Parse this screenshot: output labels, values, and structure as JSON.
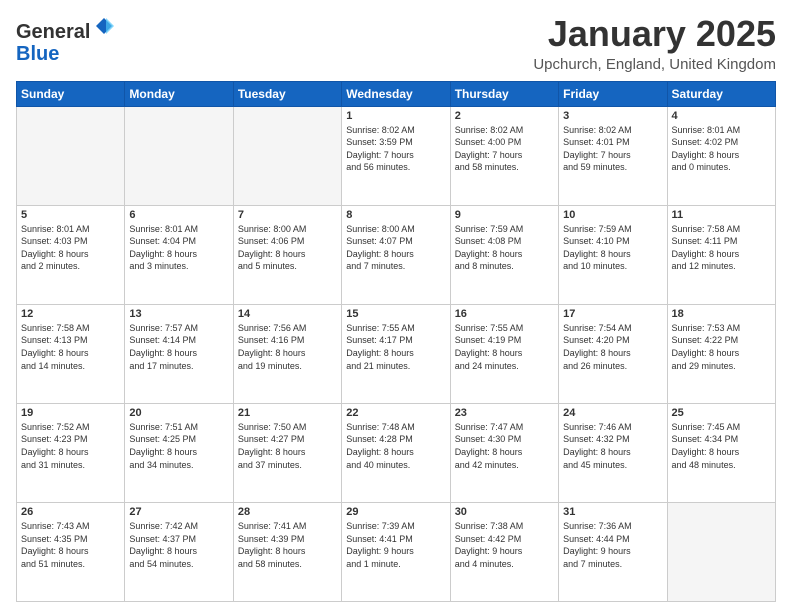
{
  "header": {
    "logo_general": "General",
    "logo_blue": "Blue",
    "month_title": "January 2025",
    "location": "Upchurch, England, United Kingdom"
  },
  "weekdays": [
    "Sunday",
    "Monday",
    "Tuesday",
    "Wednesday",
    "Thursday",
    "Friday",
    "Saturday"
  ],
  "weeks": [
    [
      {
        "day": "",
        "info": ""
      },
      {
        "day": "",
        "info": ""
      },
      {
        "day": "",
        "info": ""
      },
      {
        "day": "1",
        "info": "Sunrise: 8:02 AM\nSunset: 3:59 PM\nDaylight: 7 hours\nand 56 minutes."
      },
      {
        "day": "2",
        "info": "Sunrise: 8:02 AM\nSunset: 4:00 PM\nDaylight: 7 hours\nand 58 minutes."
      },
      {
        "day": "3",
        "info": "Sunrise: 8:02 AM\nSunset: 4:01 PM\nDaylight: 7 hours\nand 59 minutes."
      },
      {
        "day": "4",
        "info": "Sunrise: 8:01 AM\nSunset: 4:02 PM\nDaylight: 8 hours\nand 0 minutes."
      }
    ],
    [
      {
        "day": "5",
        "info": "Sunrise: 8:01 AM\nSunset: 4:03 PM\nDaylight: 8 hours\nand 2 minutes."
      },
      {
        "day": "6",
        "info": "Sunrise: 8:01 AM\nSunset: 4:04 PM\nDaylight: 8 hours\nand 3 minutes."
      },
      {
        "day": "7",
        "info": "Sunrise: 8:00 AM\nSunset: 4:06 PM\nDaylight: 8 hours\nand 5 minutes."
      },
      {
        "day": "8",
        "info": "Sunrise: 8:00 AM\nSunset: 4:07 PM\nDaylight: 8 hours\nand 7 minutes."
      },
      {
        "day": "9",
        "info": "Sunrise: 7:59 AM\nSunset: 4:08 PM\nDaylight: 8 hours\nand 8 minutes."
      },
      {
        "day": "10",
        "info": "Sunrise: 7:59 AM\nSunset: 4:10 PM\nDaylight: 8 hours\nand 10 minutes."
      },
      {
        "day": "11",
        "info": "Sunrise: 7:58 AM\nSunset: 4:11 PM\nDaylight: 8 hours\nand 12 minutes."
      }
    ],
    [
      {
        "day": "12",
        "info": "Sunrise: 7:58 AM\nSunset: 4:13 PM\nDaylight: 8 hours\nand 14 minutes."
      },
      {
        "day": "13",
        "info": "Sunrise: 7:57 AM\nSunset: 4:14 PM\nDaylight: 8 hours\nand 17 minutes."
      },
      {
        "day": "14",
        "info": "Sunrise: 7:56 AM\nSunset: 4:16 PM\nDaylight: 8 hours\nand 19 minutes."
      },
      {
        "day": "15",
        "info": "Sunrise: 7:55 AM\nSunset: 4:17 PM\nDaylight: 8 hours\nand 21 minutes."
      },
      {
        "day": "16",
        "info": "Sunrise: 7:55 AM\nSunset: 4:19 PM\nDaylight: 8 hours\nand 24 minutes."
      },
      {
        "day": "17",
        "info": "Sunrise: 7:54 AM\nSunset: 4:20 PM\nDaylight: 8 hours\nand 26 minutes."
      },
      {
        "day": "18",
        "info": "Sunrise: 7:53 AM\nSunset: 4:22 PM\nDaylight: 8 hours\nand 29 minutes."
      }
    ],
    [
      {
        "day": "19",
        "info": "Sunrise: 7:52 AM\nSunset: 4:23 PM\nDaylight: 8 hours\nand 31 minutes."
      },
      {
        "day": "20",
        "info": "Sunrise: 7:51 AM\nSunset: 4:25 PM\nDaylight: 8 hours\nand 34 minutes."
      },
      {
        "day": "21",
        "info": "Sunrise: 7:50 AM\nSunset: 4:27 PM\nDaylight: 8 hours\nand 37 minutes."
      },
      {
        "day": "22",
        "info": "Sunrise: 7:48 AM\nSunset: 4:28 PM\nDaylight: 8 hours\nand 40 minutes."
      },
      {
        "day": "23",
        "info": "Sunrise: 7:47 AM\nSunset: 4:30 PM\nDaylight: 8 hours\nand 42 minutes."
      },
      {
        "day": "24",
        "info": "Sunrise: 7:46 AM\nSunset: 4:32 PM\nDaylight: 8 hours\nand 45 minutes."
      },
      {
        "day": "25",
        "info": "Sunrise: 7:45 AM\nSunset: 4:34 PM\nDaylight: 8 hours\nand 48 minutes."
      }
    ],
    [
      {
        "day": "26",
        "info": "Sunrise: 7:43 AM\nSunset: 4:35 PM\nDaylight: 8 hours\nand 51 minutes."
      },
      {
        "day": "27",
        "info": "Sunrise: 7:42 AM\nSunset: 4:37 PM\nDaylight: 8 hours\nand 54 minutes."
      },
      {
        "day": "28",
        "info": "Sunrise: 7:41 AM\nSunset: 4:39 PM\nDaylight: 8 hours\nand 58 minutes."
      },
      {
        "day": "29",
        "info": "Sunrise: 7:39 AM\nSunset: 4:41 PM\nDaylight: 9 hours\nand 1 minute."
      },
      {
        "day": "30",
        "info": "Sunrise: 7:38 AM\nSunset: 4:42 PM\nDaylight: 9 hours\nand 4 minutes."
      },
      {
        "day": "31",
        "info": "Sunrise: 7:36 AM\nSunset: 4:44 PM\nDaylight: 9 hours\nand 7 minutes."
      },
      {
        "day": "",
        "info": ""
      }
    ]
  ]
}
